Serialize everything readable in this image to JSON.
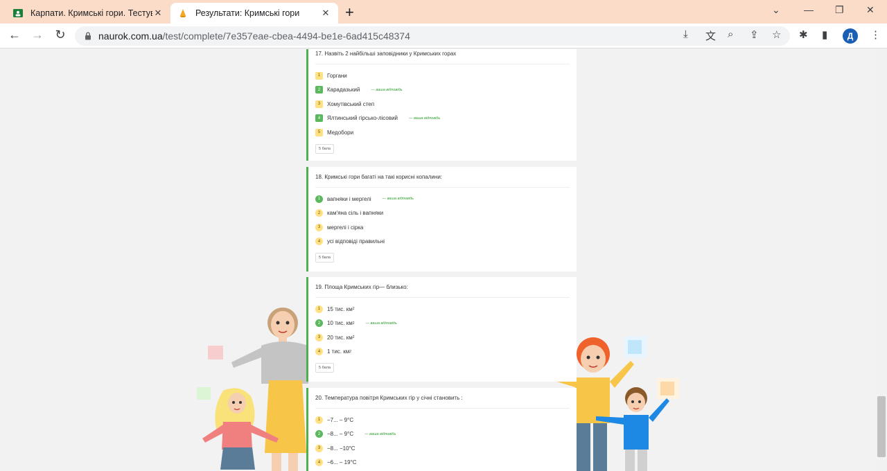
{
  "tabs": [
    {
      "title": "Карпати. Кримські гори. Тестува",
      "icon": "classroom-icon"
    },
    {
      "title": "Результати: Кримські гори",
      "icon": "naurok-icon"
    }
  ],
  "address": {
    "host": "naurok.com.ua",
    "path": "/test/complete/7e357eae-cbea-4494-be1e-6ad415c48374"
  },
  "profile_initial": "Д",
  "your_answer_label": "— ваша відповідь",
  "questions": [
    {
      "title": "17. Назвіть 2 найбільші заповідники у Кримських горах",
      "answers": [
        {
          "n": "1",
          "text": " Горгани",
          "chosen": false
        },
        {
          "n": "2",
          "text": "Карадазький",
          "chosen": true
        },
        {
          "n": "3",
          "text": "Хомутівський степ",
          "chosen": false
        },
        {
          "n": "4",
          "text": "Ялтинський гірсько-лісовий",
          "chosen": true
        },
        {
          "n": "5",
          "text": "Медобори",
          "chosen": false
        }
      ],
      "score": "5 бала"
    },
    {
      "title": "18. Кримські гори багаті на такі корисні копалини:",
      "answers": [
        {
          "n": "1",
          "text": "вапняки і мергелі",
          "chosen": true
        },
        {
          "n": "2",
          "text": "кам'яна сіль і вапняки",
          "chosen": false
        },
        {
          "n": "3",
          "text": " мергелі і сірка",
          "chosen": false
        },
        {
          "n": "4",
          "text": "усі відповіді правильні",
          "chosen": false
        }
      ],
      "score": "5 бала"
    },
    {
      "title": "19. Площа Кримських гір— близько:",
      "answers": [
        {
          "n": "1",
          "text": "15 тис. км",
          "chosen": false
        },
        {
          "n": "2",
          "text": "10 тис. км",
          "chosen": true
        },
        {
          "n": "3",
          "text": "20 тис. км",
          "chosen": false
        },
        {
          "n": "4",
          "text": "1 тис. км",
          "chosen": false
        }
      ],
      "sup": "2",
      "score": "5 бала"
    },
    {
      "title": "20. Температура повітря Кримських гір у січні становить :",
      "answers": [
        {
          "n": "1",
          "text": "−7... – 9°С",
          "chosen": false
        },
        {
          "n": "2",
          "text": "−8... – 9°С",
          "chosen": true
        },
        {
          "n": "3",
          "text": "−8... −10°С",
          "chosen": false
        },
        {
          "n": "4",
          "text": "−6... – 19°С",
          "chosen": false
        }
      ]
    }
  ]
}
